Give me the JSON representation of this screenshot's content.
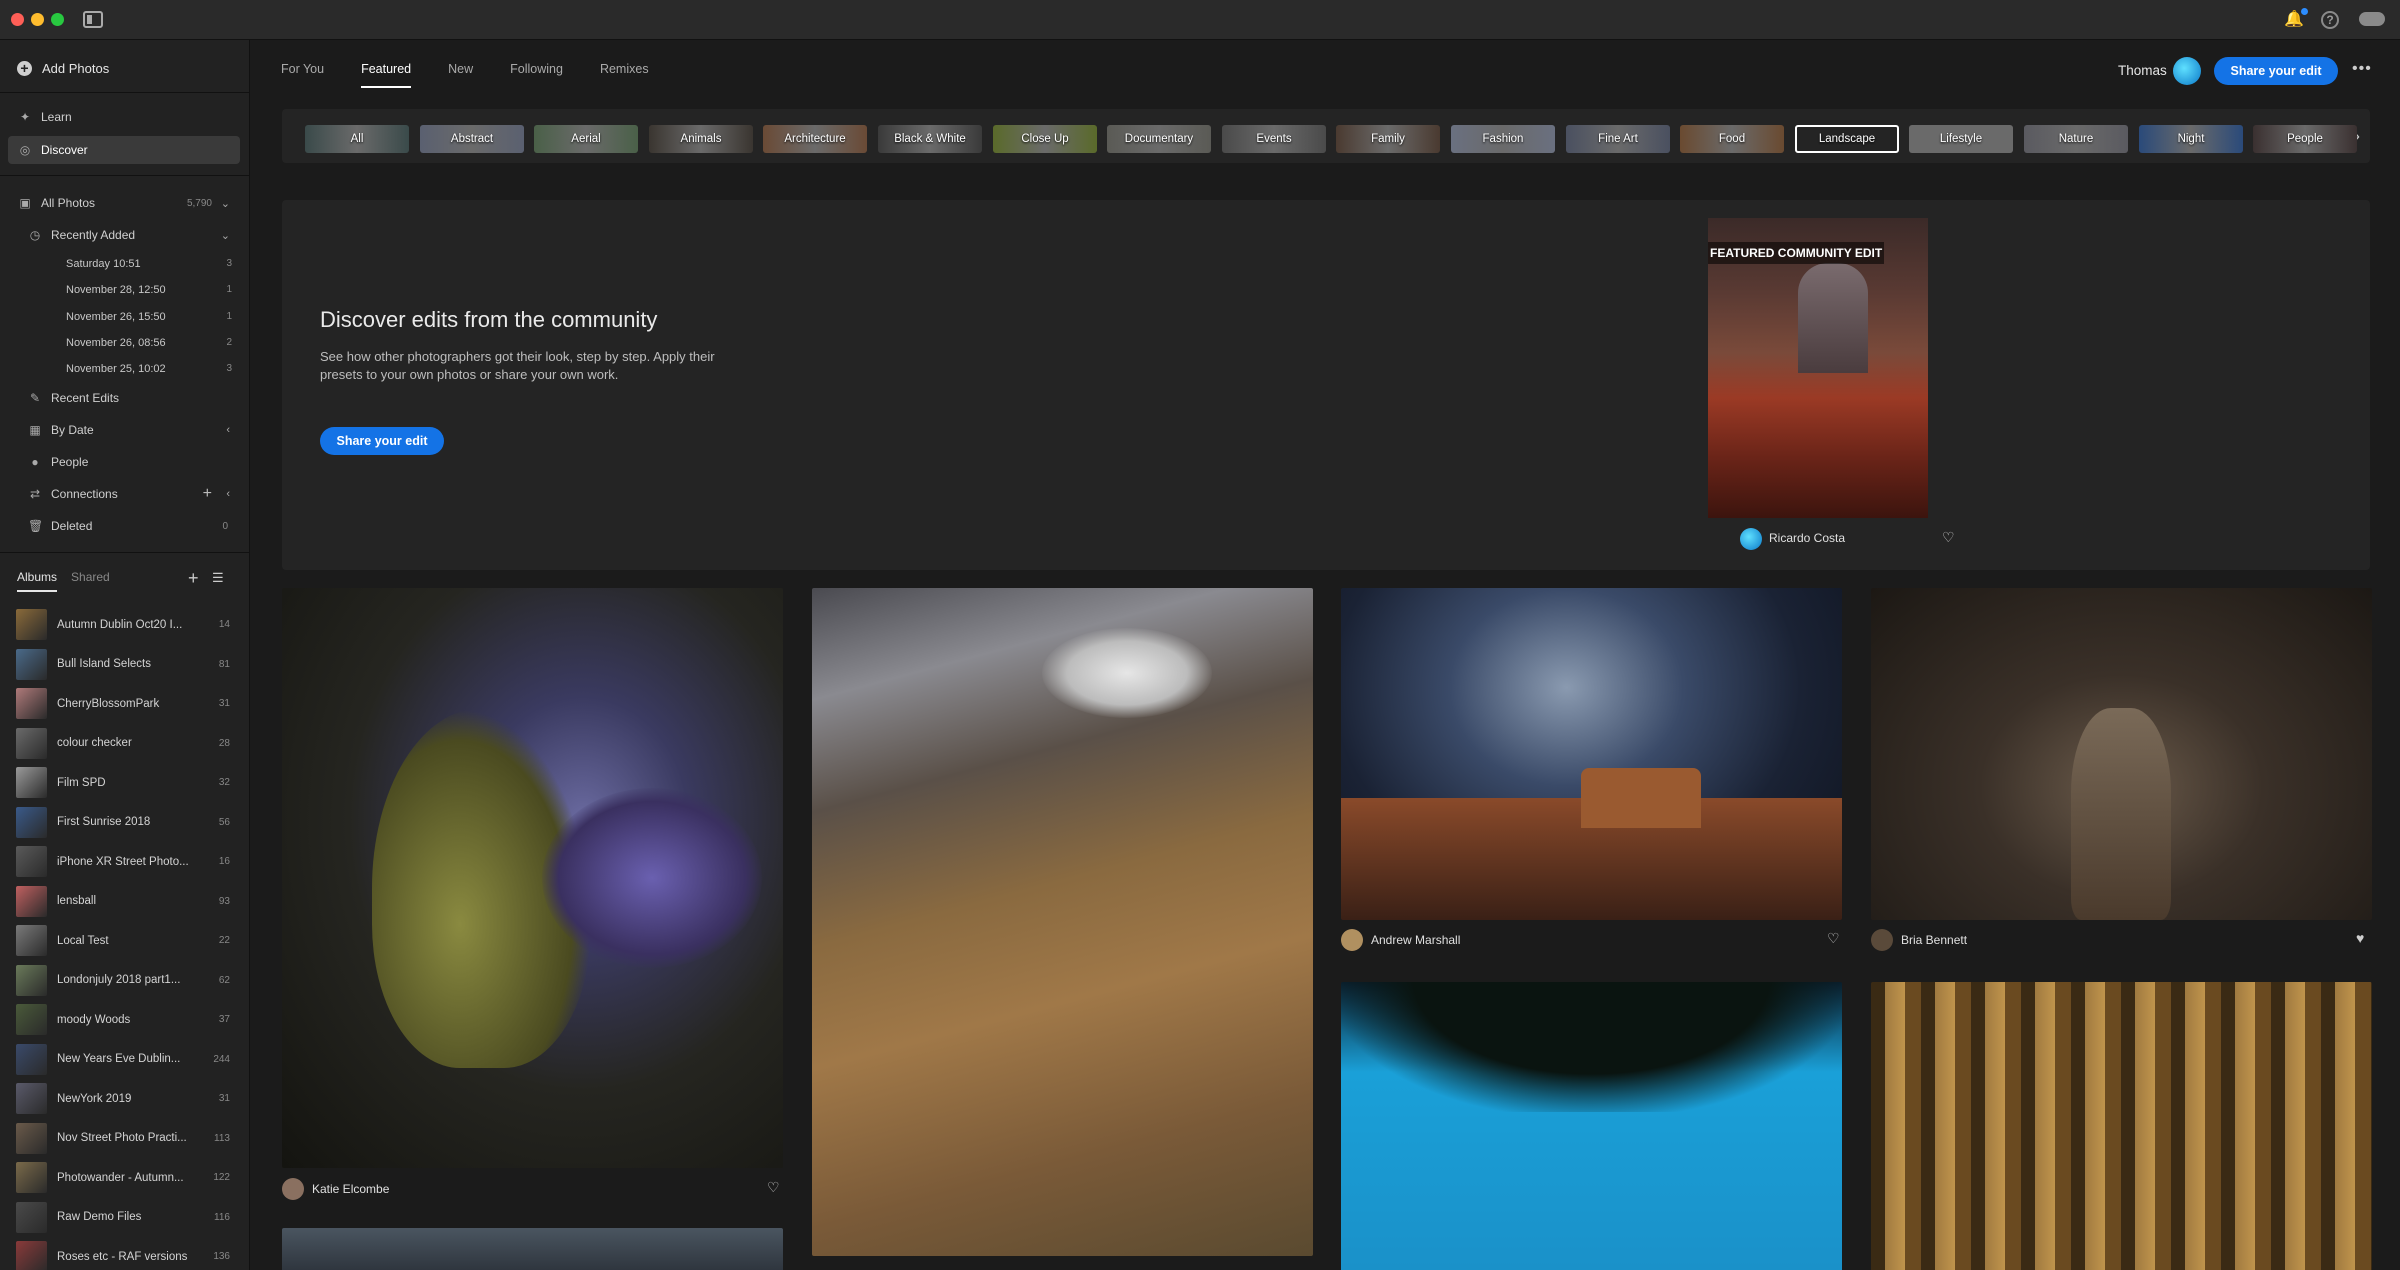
{
  "top_nav": {
    "tabs": [
      {
        "label": "For You",
        "active": false
      },
      {
        "label": "Featured",
        "active": true
      },
      {
        "label": "New",
        "active": false
      },
      {
        "label": "Following",
        "active": false
      },
      {
        "label": "Remixes",
        "active": false
      }
    ],
    "user_name": "Thomas",
    "share_button": "Share your edit",
    "more_icon": "more-horizontal-icon"
  },
  "titlebar_icons": [
    "sidebar-toggle-icon",
    "bell-icon",
    "help-icon",
    "cloud-icon"
  ],
  "sidebar": {
    "add_photos": "Add Photos",
    "learn": "Learn",
    "discover": "Discover",
    "all_photos": {
      "label": "All Photos",
      "count": "5,790"
    },
    "recently_added": {
      "label": "Recently Added"
    },
    "recent_dates": [
      {
        "label": "Saturday  10:51",
        "count": "3"
      },
      {
        "label": "November 28, 12:50",
        "count": "1"
      },
      {
        "label": "November 26, 15:50",
        "count": "1"
      },
      {
        "label": "November 26, 08:56",
        "count": "2"
      },
      {
        "label": "November 25, 10:02",
        "count": "3"
      }
    ],
    "recent_edits": "Recent Edits",
    "by_date": "By Date",
    "people": "People",
    "connections": "Connections",
    "deleted": {
      "label": "Deleted",
      "count": "0"
    },
    "albums_tab": "Albums",
    "shared_tab": "Shared",
    "albums": [
      {
        "name": "Autumn Dublin Oct20 I...",
        "count": "14",
        "color": "#8a6a3a"
      },
      {
        "name": "Bull Island Selects",
        "count": "81",
        "color": "#4a6a8a"
      },
      {
        "name": "CherryBlossomPark",
        "count": "31",
        "color": "#b07a7a"
      },
      {
        "name": "colour checker",
        "count": "28",
        "color": "#6a6a6a"
      },
      {
        "name": "Film SPD",
        "count": "32",
        "color": "#9a9a9a"
      },
      {
        "name": "First Sunrise 2018",
        "count": "56",
        "color": "#3a5a8a"
      },
      {
        "name": "iPhone XR Street Photo...",
        "count": "16",
        "color": "#5a5a5a"
      },
      {
        "name": "lensball",
        "count": "93",
        "color": "#c06060"
      },
      {
        "name": "Local Test",
        "count": "22",
        "color": "#7a7a7a"
      },
      {
        "name": "Londonjuly 2018 part1...",
        "count": "62",
        "color": "#6a7a5a"
      },
      {
        "name": "moody Woods",
        "count": "37",
        "color": "#4a5a3a"
      },
      {
        "name": "New Years Eve Dublin...",
        "count": "244",
        "color": "#3a4a6a"
      },
      {
        "name": "NewYork 2019",
        "count": "31",
        "color": "#5a5a6a"
      },
      {
        "name": "Nov Street Photo Practi...",
        "count": "113",
        "color": "#6a5a4a"
      },
      {
        "name": "Photowander - Autumn...",
        "count": "122",
        "color": "#7a6a4a"
      },
      {
        "name": "Raw Demo Files",
        "count": "116",
        "color": "#4a4a4a"
      },
      {
        "name": "Roses etc - RAF versions",
        "count": "136",
        "color": "#8a3a3a"
      }
    ]
  },
  "categories": [
    {
      "label": "All",
      "color": "#3a4a4a"
    },
    {
      "label": "Abstract",
      "color": "#5a6070"
    },
    {
      "label": "Aerial",
      "color": "#4a6048"
    },
    {
      "label": "Animals",
      "color": "#3a3530"
    },
    {
      "label": "Architecture",
      "color": "#6a4a35"
    },
    {
      "label": "Black & White",
      "color": "#3a3a3a"
    },
    {
      "label": "Close Up",
      "color": "#5a6a2a"
    },
    {
      "label": "Documentary",
      "color": "#5a5a55"
    },
    {
      "label": "Events",
      "color": "#4a4a4a"
    },
    {
      "label": "Family",
      "color": "#4a3a30"
    },
    {
      "label": "Fashion",
      "color": "#6a7080"
    },
    {
      "label": "Fine Art",
      "color": "#4a5060"
    },
    {
      "label": "Food",
      "color": "#6a4a30"
    },
    {
      "label": "Landscape",
      "color": "#3a3a3a",
      "selected": true
    },
    {
      "label": "Lifestyle",
      "color": "#6a6a6a"
    },
    {
      "label": "Nature",
      "color": "#5a5a60"
    },
    {
      "label": "Night",
      "color": "#2a4a7a"
    },
    {
      "label": "People",
      "color": "#3a3030"
    }
  ],
  "hero": {
    "title": "Discover edits from the community",
    "text": "See how other photographers got their look, step by step. Apply their presets to your own photos or share your own work.",
    "button": "Share your edit",
    "featured_label": "FEATURED COMMUNITY EDIT",
    "featured_author": "Ricardo Costa"
  },
  "photos": [
    {
      "author": "Katie Elcombe"
    },
    {
      "author": ""
    },
    {
      "author": "Andrew Marshall"
    },
    {
      "author": "Bria Bennett"
    }
  ]
}
